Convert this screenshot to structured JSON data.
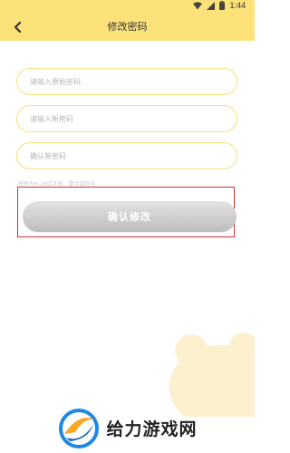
{
  "status_bar": {
    "time": "1:44",
    "icons": [
      "wifi-icon",
      "signal-icon",
      "battery-icon"
    ]
  },
  "header": {
    "title": "修改密码",
    "back_icon": "chevron-left-icon"
  },
  "form": {
    "old_password": {
      "placeholder": "请输入原始密码",
      "value": ""
    },
    "new_password": {
      "placeholder": "请输入新密码",
      "value": ""
    },
    "confirm_password": {
      "placeholder": "确认新密码",
      "value": ""
    },
    "hint": "密码为6-16位字母、数字或符号"
  },
  "confirm_button": {
    "label": "确认修改"
  },
  "watermark": {
    "text": "给力游戏网"
  },
  "colors": {
    "header_bg": "#fde27a",
    "field_border": "#f4e07a",
    "button_bg": "#cccccc",
    "highlight": "#d8302f",
    "decoration": "#fdf0cf"
  }
}
